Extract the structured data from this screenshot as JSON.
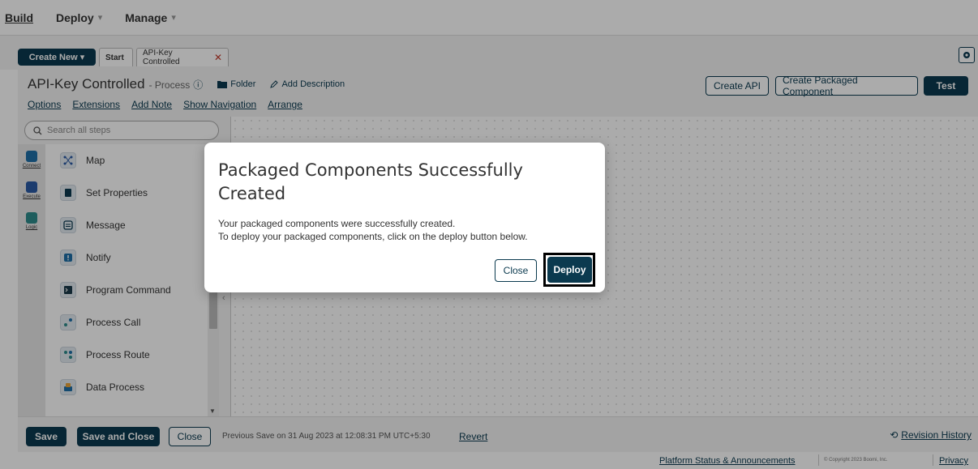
{
  "topnav": {
    "items": [
      {
        "label": "Build",
        "has_caret": false
      },
      {
        "label": "Deploy",
        "has_caret": true
      },
      {
        "label": "Manage",
        "has_caret": true
      }
    ]
  },
  "tabbar": {
    "create_new": "Create New",
    "tabs": [
      {
        "label": "Start"
      },
      {
        "label": "API-Key Controlled"
      }
    ]
  },
  "process": {
    "title": "API-Key Controlled",
    "subtitle": "- Process",
    "folder_link": "Folder",
    "description_link": "Add Description",
    "menu": [
      "Options",
      "Extensions",
      "Add Note",
      "Show Navigation",
      "Arrange"
    ],
    "buttons": {
      "create_api": "Create API",
      "create_packaged": "Create Packaged Component",
      "test": "Test"
    }
  },
  "palette": {
    "search_placeholder": "Search all steps",
    "categories": [
      {
        "label": "Connect",
        "color": "#1e6fa8"
      },
      {
        "label": "Execute",
        "color": "#2b5aa5"
      },
      {
        "label": "Logic",
        "color": "#2e8b8b"
      }
    ],
    "steps": [
      {
        "label": "Map",
        "icon": "map-icon"
      },
      {
        "label": "Set Properties",
        "icon": "set-properties-icon"
      },
      {
        "label": "Message",
        "icon": "message-icon"
      },
      {
        "label": "Notify",
        "icon": "notify-icon"
      },
      {
        "label": "Program Command",
        "icon": "program-command-icon"
      },
      {
        "label": "Process Call",
        "icon": "process-call-icon"
      },
      {
        "label": "Process Route",
        "icon": "process-route-icon"
      },
      {
        "label": "Data Process",
        "icon": "data-process-icon"
      }
    ]
  },
  "bottombar": {
    "save": "Save",
    "save_and_close": "Save and Close",
    "close": "Close",
    "previous_save": "Previous Save on 31 Aug 2023 at 12:08:31 PM UTC+5:30",
    "revert": "Revert",
    "revision_history": "Revision History"
  },
  "footer": {
    "status": "Platform Status & Announcements",
    "copyright": "© Copyright 2023 Boomi, Inc.",
    "privacy": "Privacy"
  },
  "modal": {
    "title": "Packaged Components Successfully Created",
    "line1": "Your packaged components were successfully created.",
    "line2": "To deploy your packaged components, click on the deploy button below.",
    "close": "Close",
    "deploy": "Deploy"
  },
  "colors": {
    "primary": "#0b3a4f",
    "highlight_border": "#000000"
  }
}
